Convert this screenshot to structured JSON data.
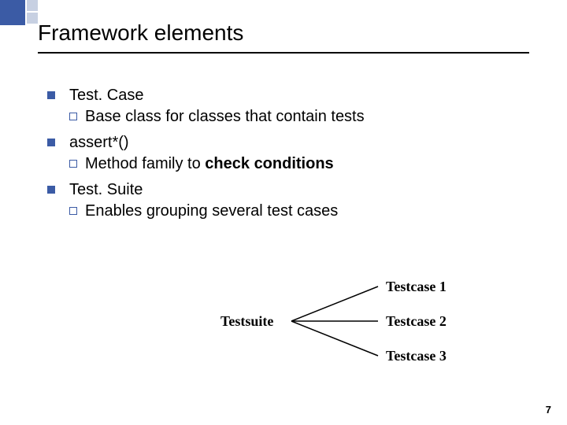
{
  "title": "Framework elements",
  "items": [
    {
      "label": "Test. Case",
      "sub_prefix": "Base",
      "sub_rest": " class for classes that contain tests"
    },
    {
      "label": "assert*()",
      "sub_prefix": "Method",
      "sub_rest_a": " family to ",
      "sub_rest_bold": "check conditions"
    },
    {
      "label": "Test. Suite",
      "sub_prefix": "Enables",
      "sub_rest": " grouping several test cases"
    }
  ],
  "diagram": {
    "suite": "Testsuite",
    "cases": [
      "Testcase 1",
      "Testcase 2",
      "Testcase 3"
    ]
  },
  "page": "7"
}
